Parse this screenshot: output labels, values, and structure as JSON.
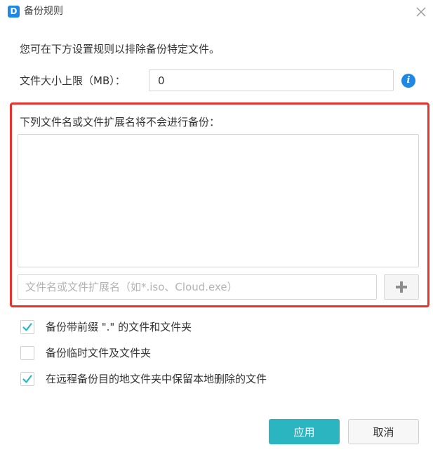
{
  "window": {
    "logo_text": "D",
    "title": "备份规则"
  },
  "intro": "您可在下方设置规则以排除备份特定文件。",
  "size_limit": {
    "label": "文件大小上限（MB）：",
    "value": "0"
  },
  "exclude": {
    "label": "下列文件名或文件扩展名将不会进行备份：",
    "entries": [],
    "input_placeholder": "文件名或文件扩展名（如*.iso、Cloud.exe）"
  },
  "options": [
    {
      "label": "备份带前缀 \".\" 的文件和文件夹",
      "checked": true
    },
    {
      "label": "备份临时文件及文件夹",
      "checked": false
    },
    {
      "label": "在远程备份目的地文件夹中保留本地删除的文件",
      "checked": true
    }
  ],
  "buttons": {
    "apply": "应用",
    "cancel": "取消"
  },
  "colors": {
    "accent": "#2bb5c1",
    "info": "#1e88e5",
    "highlight": "#e8322b",
    "check": "#2bb5c1"
  }
}
